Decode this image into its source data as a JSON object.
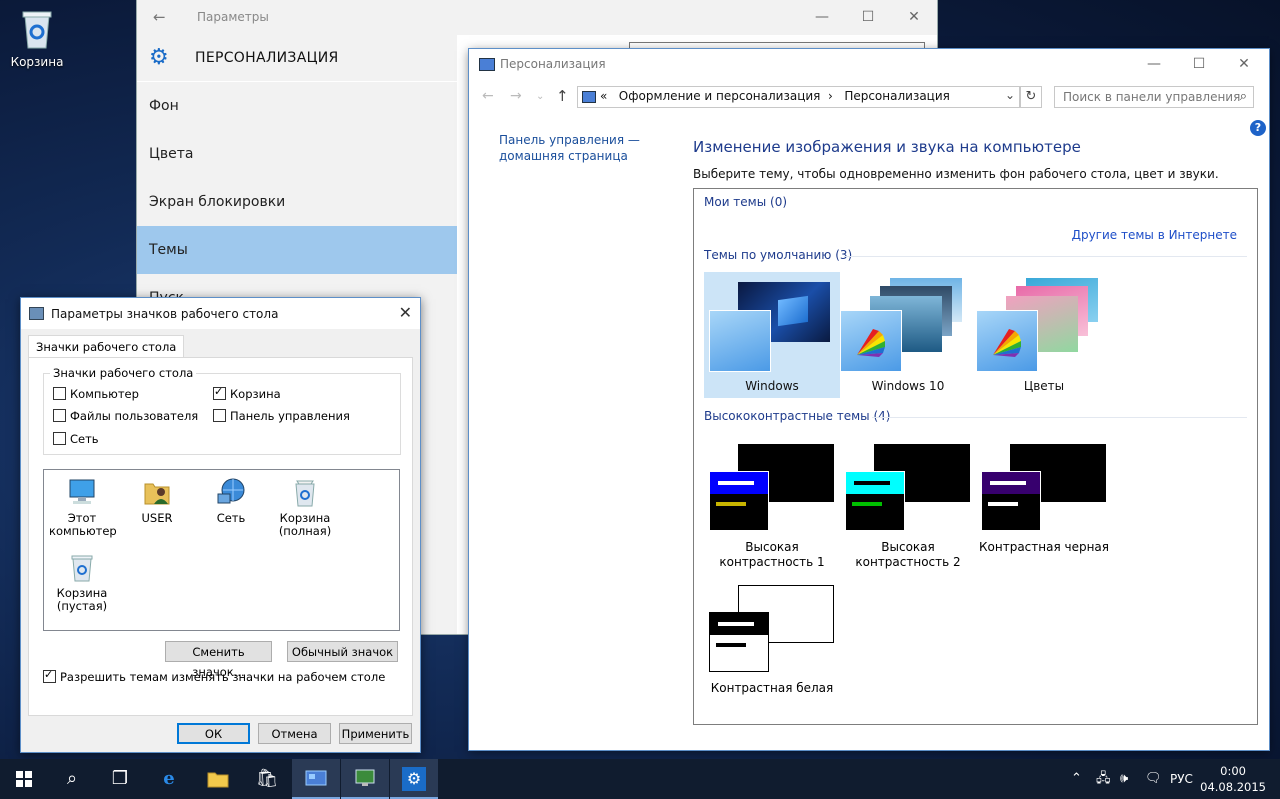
{
  "desktop": {
    "recycle_bin_label": "Корзина"
  },
  "settings": {
    "title": "Параметры",
    "header": "ПЕРСОНАЛИЗАЦИЯ",
    "nav": [
      {
        "label": "Фон",
        "selected": false
      },
      {
        "label": "Цвета",
        "selected": false
      },
      {
        "label": "Экран блокировки",
        "selected": false
      },
      {
        "label": "Темы",
        "selected": true
      },
      {
        "label": "Пуск",
        "selected": false
      }
    ]
  },
  "control_panel": {
    "title": "Персонализация",
    "breadcrumb": {
      "prefix": "«",
      "items": [
        "Оформление и персонализация",
        "Персонализация"
      ],
      "separator": "›"
    },
    "search_placeholder": "Поиск в панели управления",
    "help": "?",
    "home_link": "Панель управления — домашняя страница",
    "heading": "Изменение изображения и звука на компьютере",
    "subheading": "Выберите тему, чтобы одновременно изменить фон рабочего стола, цвет и звуки.",
    "my_themes": "Мои темы (0)",
    "more_themes_link": "Другие темы в Интернете",
    "default_themes_header": "Темы по умолчанию (3)",
    "default_themes": [
      {
        "label": "Windows",
        "selected": true
      },
      {
        "label": "Windows 10",
        "selected": false
      },
      {
        "label": "Цветы",
        "selected": false
      }
    ],
    "high_contrast_header": "Высококонтрастные темы (4)",
    "high_contrast_themes": [
      {
        "label_line1": "Высокая",
        "label_line2": "контрастность 1",
        "accent": "#0000ff",
        "bar": "#ffff00"
      },
      {
        "label_line1": "Высокая",
        "label_line2": "контрастность 2",
        "accent": "#00ffff",
        "bar": "#00ff00"
      },
      {
        "label_line1": "Контрастная черная",
        "label_line2": "",
        "accent": "#37006e",
        "bar": "#ffffff"
      },
      {
        "label_line1": "Контрастная белая",
        "label_line2": "",
        "accent": "#000000",
        "bar": "#000000"
      }
    ]
  },
  "icon_dialog": {
    "title": "Параметры значков рабочего стола",
    "tab": "Значки рабочего стола",
    "group_label": "Значки рабочего стола",
    "checkboxes": [
      {
        "label": "Компьютер",
        "checked": false
      },
      {
        "label": "Корзина",
        "checked": true
      },
      {
        "label": "Файлы пользователя",
        "checked": false
      },
      {
        "label": "Панель управления",
        "checked": false
      },
      {
        "label": "Сеть",
        "checked": false
      }
    ],
    "icons": [
      {
        "line1": "Этот",
        "line2": "компьютер",
        "icon": "computer-icon"
      },
      {
        "line1": "USER",
        "line2": "",
        "icon": "user-folder-icon"
      },
      {
        "line1": "Сеть",
        "line2": "",
        "icon": "network-icon"
      },
      {
        "line1": "Корзина",
        "line2": "(полная)",
        "icon": "recycle-bin-full-icon"
      },
      {
        "line1": "Корзина",
        "line2": "(пустая)",
        "icon": "recycle-bin-empty-icon"
      }
    ],
    "change_icon": "Сменить значок...",
    "default_icon": "Обычный значок",
    "allow_themes": {
      "label": "Разрешить темам изменять значки на рабочем столе",
      "checked": true
    },
    "ok": "ОК",
    "cancel": "Отмена",
    "apply": "Применить"
  },
  "taskbar": {
    "language": "РУС",
    "time": "0:00",
    "date": "04.08.2015"
  }
}
